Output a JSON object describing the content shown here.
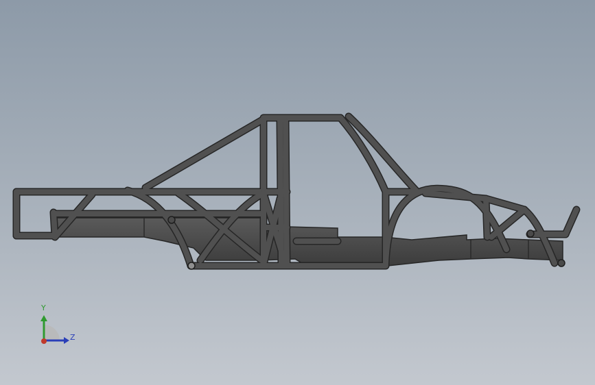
{
  "viewport": {
    "background_top": "#8d9aa8",
    "background_bottom": "#c3c8cf",
    "model_color": "#4a4a4a",
    "model_edge_color": "#262626"
  },
  "model": {
    "name": "tube-frame-chassis",
    "view": "side"
  },
  "triad": {
    "y_label": "Y",
    "z_label": "Z",
    "y_color": "#2f9a2f",
    "z_color": "#2a3fb8",
    "x_color": "#c0392b"
  }
}
